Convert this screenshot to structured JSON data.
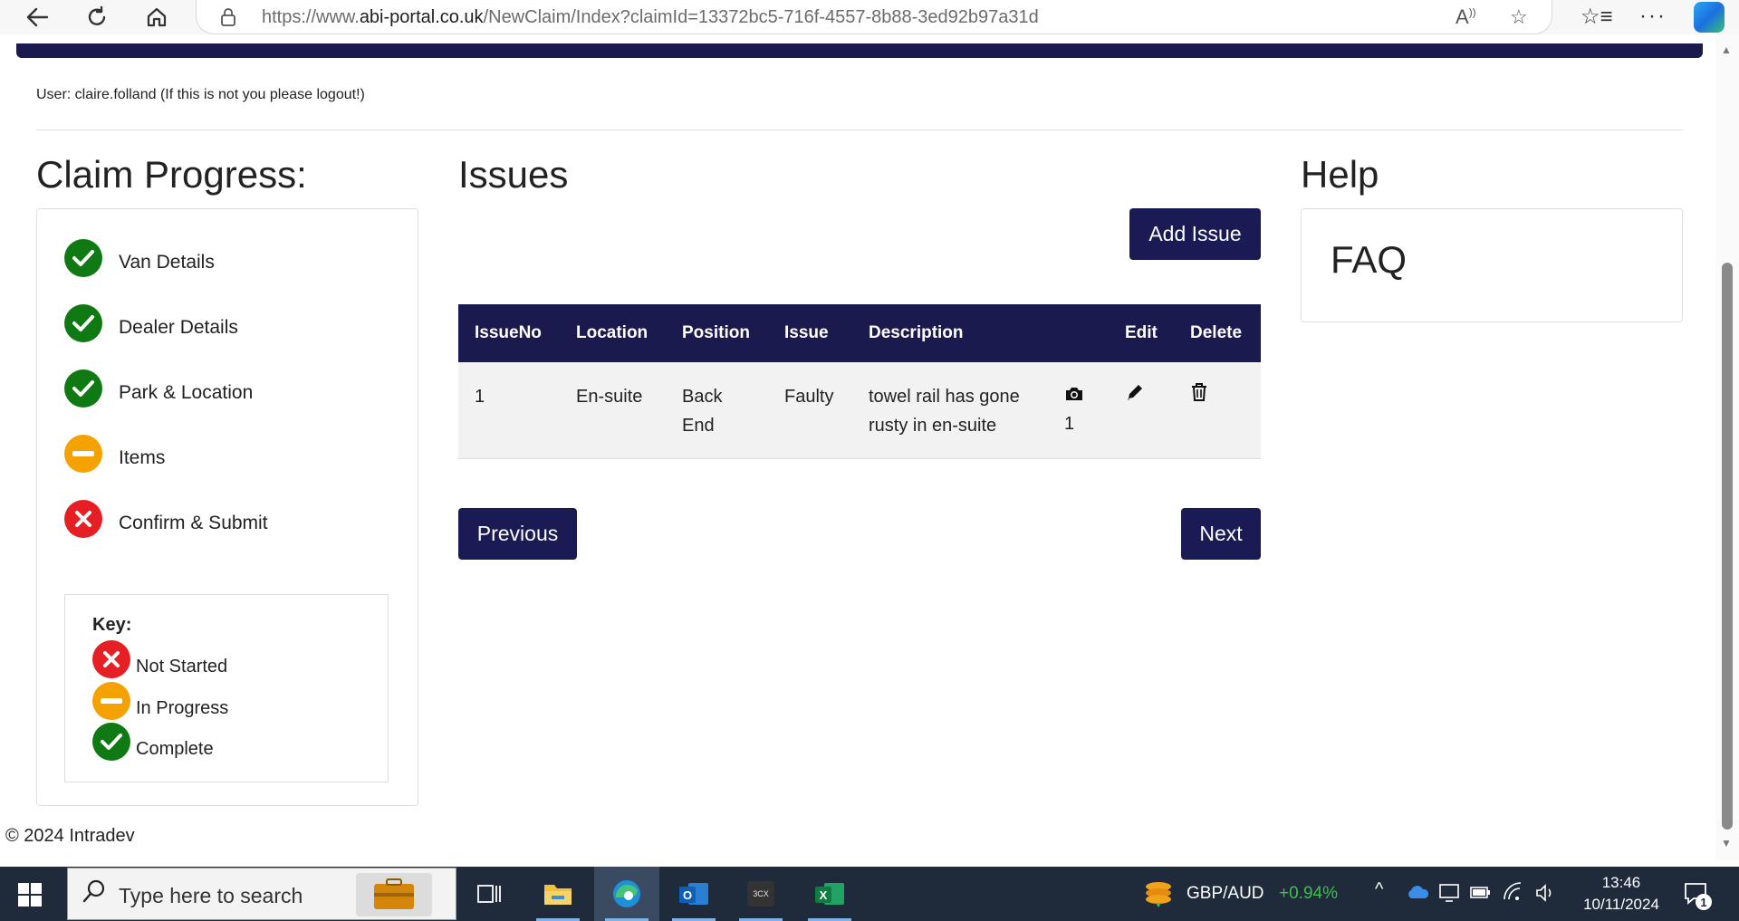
{
  "browser": {
    "url_prefix": "https://www.",
    "url_domain": "abi-portal.co.uk",
    "url_path": "/NewClaim/Index?claimId=13372bc5-716f-4557-8b88-3ed92b97a31d"
  },
  "user_line": "User: claire.folland (If this is not you please logout!)",
  "progress": {
    "title": "Claim Progress:",
    "steps": [
      {
        "label": "Van Details",
        "status": "complete"
      },
      {
        "label": "Dealer Details",
        "status": "complete"
      },
      {
        "label": "Park & Location",
        "status": "complete"
      },
      {
        "label": "Items",
        "status": "in-progress"
      },
      {
        "label": "Confirm & Submit",
        "status": "not-started"
      }
    ],
    "key": {
      "title": "Key:",
      "items": [
        {
          "label": "Not Started",
          "status": "not-started"
        },
        {
          "label": "In Progress",
          "status": "in-progress"
        },
        {
          "label": "Complete",
          "status": "complete"
        }
      ]
    }
  },
  "issues": {
    "title": "Issues",
    "add_label": "Add Issue",
    "columns": [
      "IssueNo",
      "Location",
      "Position",
      "Issue",
      "Description",
      "",
      "Edit",
      "Delete"
    ],
    "rows": [
      {
        "no": "1",
        "location": "En-suite",
        "position": "Back End",
        "issue": "Faulty",
        "description": "towel rail has gone rusty in en-suite",
        "photo_count": "1"
      }
    ],
    "previous_label": "Previous",
    "next_label": "Next"
  },
  "help": {
    "title": "Help",
    "faq": "FAQ"
  },
  "footer": "© 2024 Intradev",
  "taskbar": {
    "search_placeholder": "Type here to search",
    "ticker_pair": "GBP/AUD",
    "ticker_change": "+0.94%",
    "time": "13:46",
    "date": "10/11/2024",
    "notifications": "1"
  },
  "colors": {
    "navy": "#1a1a4f",
    "complete": "#0f7a13",
    "in_progress": "#f5a100",
    "not_started": "#e51f24"
  }
}
